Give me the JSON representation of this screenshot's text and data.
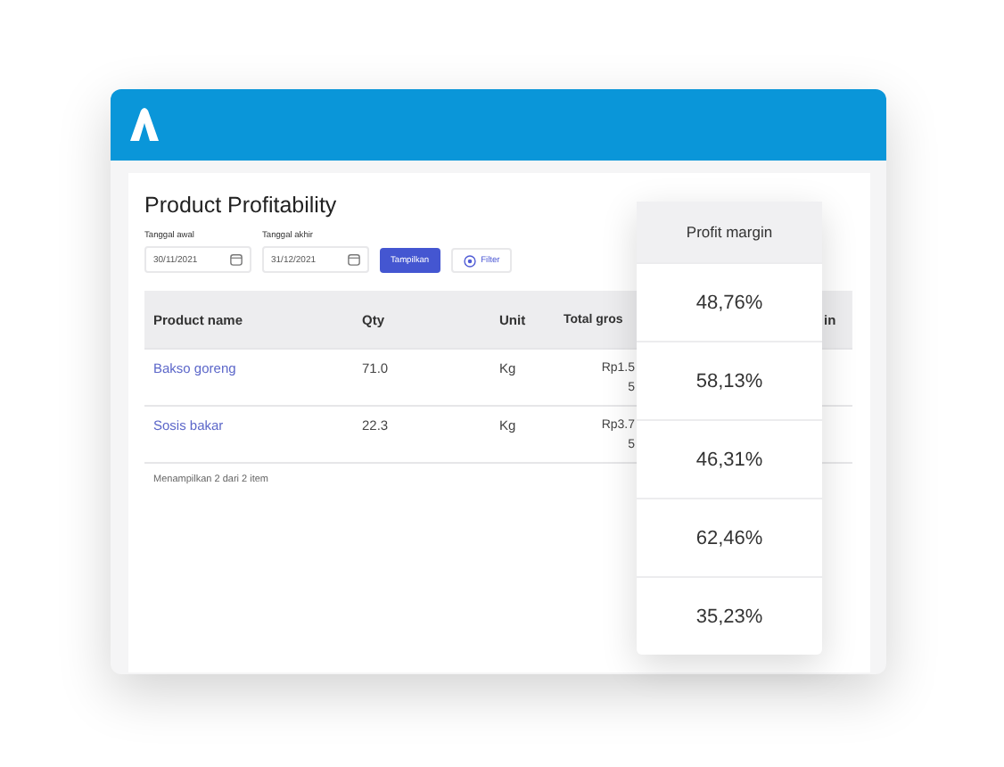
{
  "title": "Product Profitability",
  "filters": [
    {
      "label": "Tanggal awal",
      "value": "30/11/2021"
    },
    {
      "label": "Tanggal akhir",
      "value": "31/12/2021"
    }
  ],
  "show_button": "Tampilkan",
  "filter_button": "Filter",
  "table": {
    "columns": [
      "Product name",
      "Qty",
      "Unit",
      "Total gros",
      "in"
    ],
    "rows": [
      {
        "name": "Bakso goreng",
        "qty": "71.0",
        "unit": "Kg",
        "gross": [
          "Rp1.5",
          "5"
        ]
      },
      {
        "name": "Sosis bakar",
        "qty": "22.3",
        "unit": "Kg",
        "gross": [
          "Rp3.7",
          "5"
        ]
      }
    ],
    "footer": "Menampilkan 2 dari 2 item"
  },
  "overlay": {
    "heading": "Profit margin",
    "values": [
      "48,76%",
      "58,13%",
      "46,31%",
      "62,46%",
      "35,23%"
    ]
  }
}
